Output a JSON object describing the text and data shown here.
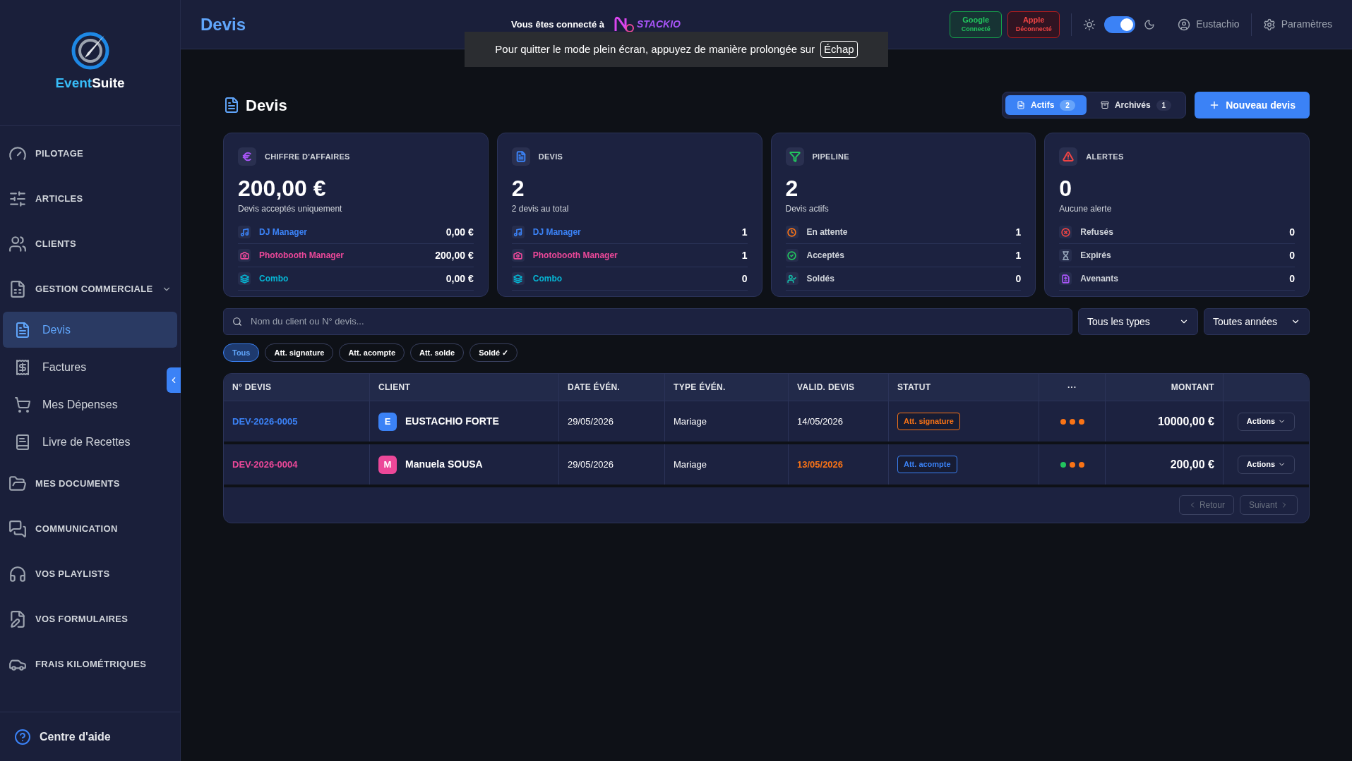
{
  "sidebar": {
    "logo": {
      "first": "Event",
      "second": "Suite"
    },
    "items": [
      {
        "label": "PILOTAGE",
        "kind": "section",
        "selected": false
      },
      {
        "label": "ARTICLES",
        "kind": "section",
        "selected": false
      },
      {
        "label": "CLIENTS",
        "kind": "section",
        "selected": false
      },
      {
        "label": "GESTION COMMERCIALE",
        "kind": "group",
        "selected": false,
        "expanded": true,
        "children": [
          {
            "label": "Devis",
            "selected": true
          },
          {
            "label": "Factures",
            "selected": false
          },
          {
            "label": "Mes Dépenses",
            "selected": false
          },
          {
            "label": "Livre de Recettes",
            "selected": false
          }
        ]
      },
      {
        "label": "MES DOCUMENTS",
        "kind": "section",
        "selected": false
      },
      {
        "label": "COMMUNICATION",
        "kind": "section",
        "selected": false
      },
      {
        "label": "VOS PLAYLISTS",
        "kind": "section",
        "selected": false
      },
      {
        "label": "VOS FORMULAIRES",
        "kind": "section",
        "selected": false
      },
      {
        "label": "FRAIS KILOMÉTRIQUES",
        "kind": "section",
        "selected": false
      }
    ],
    "help": "Centre d'aide"
  },
  "header": {
    "title": "Devis",
    "connected_label": "Vous êtes connecté à",
    "brand": "STACKIO",
    "accounts": [
      {
        "name": "Google",
        "status": "Connecté",
        "connected": true
      },
      {
        "name": "Apple",
        "status": "Déconnecté",
        "connected": false
      }
    ],
    "dark_mode": {
      "on": true
    },
    "user": "Eustachio",
    "settings": "Paramètres"
  },
  "fullscreen_notice": {
    "text": "Pour quitter le mode plein écran, appuyez de manière prolongée sur",
    "key": "Échap"
  },
  "page": {
    "title": "Devis",
    "view_tabs": [
      {
        "label": "Actifs",
        "count": "2",
        "selected": true
      },
      {
        "label": "Archivés",
        "count": "1",
        "selected": false
      }
    ],
    "new_button": "Nouveau devis"
  },
  "cards": [
    {
      "title": "CHIFFRE D'AFFAIRES",
      "color": "#a855f7",
      "value": "200,00 €",
      "subtitle": "Devis acceptés uniquement",
      "rows": [
        {
          "label": "DJ Manager",
          "value": "0,00 €",
          "color": "#3b82f6"
        },
        {
          "label": "Photobooth Manager",
          "value": "200,00 €",
          "color": "#ec4899"
        },
        {
          "label": "Combo",
          "value": "0,00 €",
          "color": "#06b6d4"
        }
      ]
    },
    {
      "title": "DEVIS",
      "color": "#3b82f6",
      "value": "2",
      "subtitle": "2 devis au total",
      "rows": [
        {
          "label": "DJ Manager",
          "value": "1",
          "color": "#3b82f6"
        },
        {
          "label": "Photobooth Manager",
          "value": "1",
          "color": "#ec4899"
        },
        {
          "label": "Combo",
          "value": "0",
          "color": "#06b6d4"
        }
      ]
    },
    {
      "title": "PIPELINE",
      "color": "#22c55e",
      "value": "2",
      "subtitle": "Devis actifs",
      "rows": [
        {
          "label": "En attente",
          "value": "1",
          "color": "#f97316"
        },
        {
          "label": "Acceptés",
          "value": "1",
          "color": "#22c55e"
        },
        {
          "label": "Soldés",
          "value": "0",
          "color": "#14b8a6"
        }
      ]
    },
    {
      "title": "ALERTES",
      "color": "#ef4444",
      "value": "0",
      "subtitle": "Aucune alerte",
      "rows": [
        {
          "label": "Refusés",
          "value": "0",
          "color": "#ef4444"
        },
        {
          "label": "Expirés",
          "value": "0",
          "color": "#94a3b8"
        },
        {
          "label": "Avenants",
          "value": "0",
          "color": "#a855f7"
        }
      ]
    }
  ],
  "search": {
    "placeholder": "Nom du client ou N° devis..."
  },
  "selects": [
    "Tous les types",
    "Toutes années"
  ],
  "filters": [
    {
      "label": "Tous",
      "selected": true
    },
    {
      "label": "Att. signature",
      "selected": false
    },
    {
      "label": "Att. acompte",
      "selected": false
    },
    {
      "label": "Att. solde",
      "selected": false
    },
    {
      "label": "Soldé ✓",
      "selected": false
    }
  ],
  "table": {
    "columns": [
      "N° DEVIS",
      "CLIENT",
      "DATE ÉVÉN.",
      "TYPE ÉVÉN.",
      "VALID. DEVIS",
      "STATUT",
      "···",
      "MONTANT"
    ],
    "rows": [
      {
        "number": "DEV-2026-0005",
        "color": "#3b82f6",
        "initial": "E",
        "client": "EUSTACHIO FORTE",
        "date": "29/05/2026",
        "type": "Mariage",
        "validity": "14/05/2026",
        "overdue": false,
        "status": {
          "label": "Att. signature",
          "color": "#f97316"
        },
        "dots": [
          {
            "color": "#f97316"
          },
          {
            "color": "#f97316"
          },
          {
            "color": "#f97316"
          }
        ],
        "amount": "10000,00 €",
        "action": "Actions"
      },
      {
        "number": "DEV-2026-0004",
        "color": "#ec4899",
        "initial": "M",
        "client": "Manuela SOUSA",
        "date": "29/05/2026",
        "type": "Mariage",
        "validity": "13/05/2026",
        "overdue": true,
        "status": {
          "label": "Att. acompte",
          "color": "#3b82f6"
        },
        "dots": [
          {
            "color": "#22c55e"
          },
          {
            "color": "#f97316"
          },
          {
            "color": "#f97316"
          }
        ],
        "amount": "200,00 €",
        "action": "Actions"
      }
    ],
    "pagination": [
      {
        "label": "Retour",
        "disabled": true
      },
      {
        "label": "Suivant",
        "disabled": true
      }
    ]
  }
}
